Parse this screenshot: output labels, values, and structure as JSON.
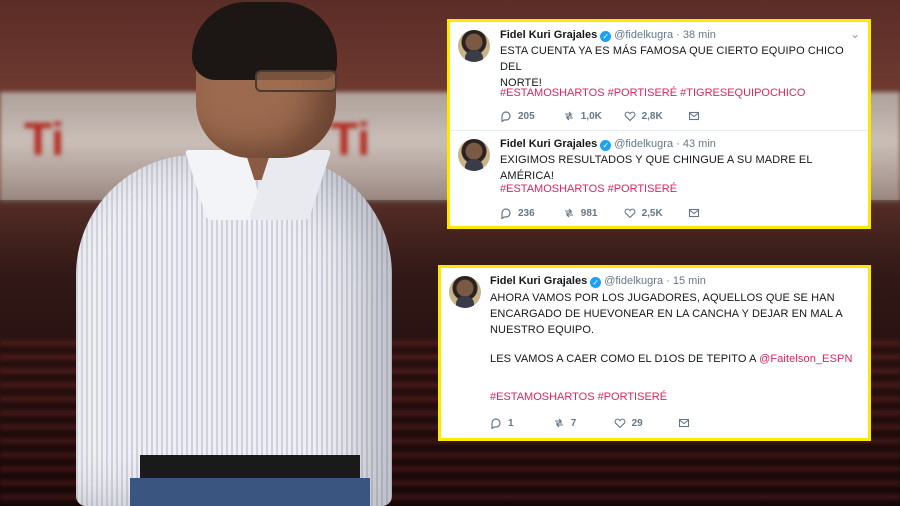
{
  "stadium": {
    "logo_text": "Ti"
  },
  "tweets_top": [
    {
      "name": "Fidel Kuri Grajales",
      "handle": "@fidelkugra",
      "time": "· 38 min",
      "text_lines": [
        "ESTA CUENTA YA ES MÁS FAMOSA QUE CIERTO EQUIPO CHICO DEL",
        "NORTE!"
      ],
      "hashtags": "#ESTAMOSHARTOS #PORTISERÉ #TIGRESEQUIPOCHICO",
      "replies": "205",
      "retweets": "1,0K",
      "likes": "2,8K"
    },
    {
      "name": "Fidel Kuri Grajales",
      "handle": "@fidelkugra",
      "time": "· 43 min",
      "text_lines": [
        "EXIGIMOS RESULTADOS Y QUE CHINGUE A SU MADRE EL AMÉRICA!"
      ],
      "hashtags": "#ESTAMOSHARTOS #PORTISERÉ",
      "replies": "236",
      "retweets": "981",
      "likes": "2,5K"
    }
  ],
  "tweet_bottom": {
    "name": "Fidel Kuri Grajales",
    "handle": "@fidelkugra",
    "time": "· 15 min",
    "text_lines": [
      "AHORA VAMOS POR LOS JUGADORES, AQUELLOS QUE SE HAN",
      "ENCARGADO DE HUEVONEAR EN LA CANCHA Y DEJAR EN MAL A",
      "NUESTRO EQUIPO."
    ],
    "text_line_2a": "LES VAMOS A CAER COMO EL D1OS DE TEPITO A ",
    "mention": "@Faitelson_ESPN",
    "hashtags": "#ESTAMOSHARTOS #PORTISERÉ",
    "replies": "1",
    "retweets": "7",
    "likes": "29"
  },
  "colors": {
    "highlight_border": "#ffe800",
    "hashtag": "#e0245e",
    "verified": "#1da1f2"
  }
}
